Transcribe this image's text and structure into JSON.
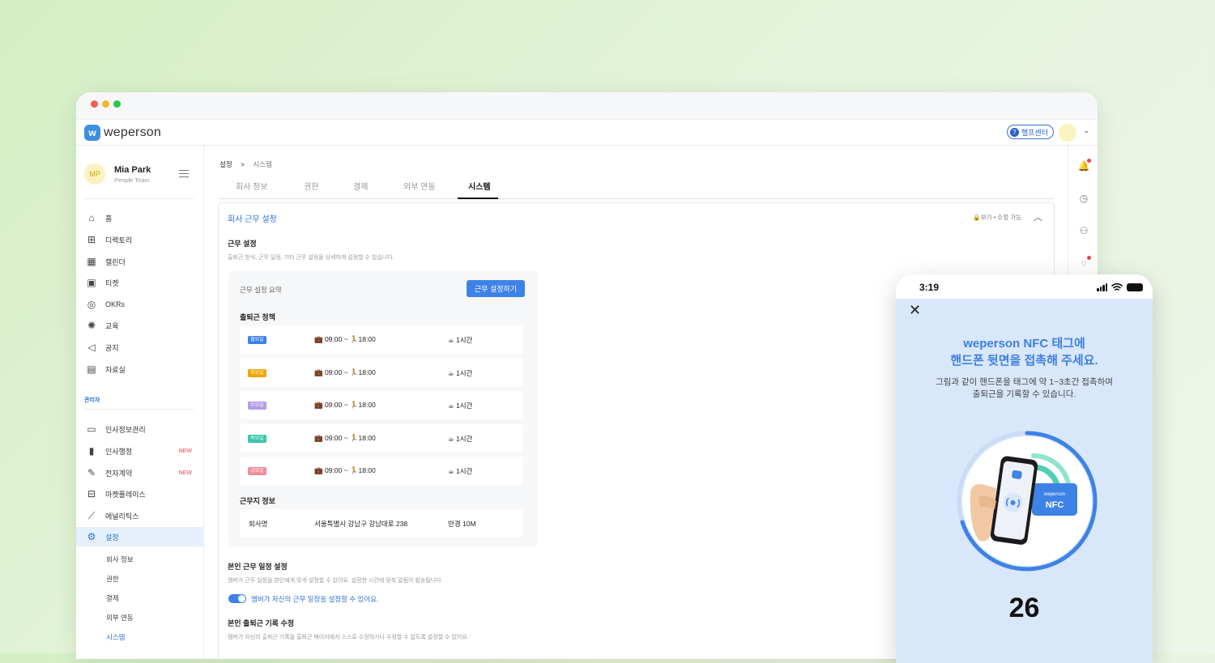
{
  "app": {
    "logo_text": "weperson",
    "logo_mark": "w",
    "help_label": "헬프센터",
    "help_icon": "?"
  },
  "profile": {
    "initials": "MP",
    "name": "Mia Park",
    "team": "People Team"
  },
  "sidebar": {
    "items": [
      {
        "label": "홈",
        "icon": "home-icon"
      },
      {
        "label": "디렉토리",
        "icon": "org-chart-icon"
      },
      {
        "label": "캘린더",
        "icon": "calendar-icon"
      },
      {
        "label": "티켓",
        "icon": "ticket-icon"
      },
      {
        "label": "OKRs",
        "icon": "target-icon"
      },
      {
        "label": "교육",
        "icon": "bulb-icon"
      },
      {
        "label": "공지",
        "icon": "megaphone-icon"
      },
      {
        "label": "자료실",
        "icon": "archive-icon"
      }
    ],
    "admin_label": "관리자",
    "admin_items": [
      {
        "label": "인사정보관리",
        "icon": "folder-user-icon",
        "badge": ""
      },
      {
        "label": "인사행정",
        "icon": "book-icon",
        "badge": "NEW"
      },
      {
        "label": "전자계약",
        "icon": "contract-icon",
        "badge": "NEW"
      },
      {
        "label": "마켓플레이스",
        "icon": "gift-icon",
        "badge": ""
      },
      {
        "label": "애널리틱스",
        "icon": "chart-icon",
        "badge": ""
      },
      {
        "label": "설정",
        "icon": "gear-icon",
        "badge": ""
      }
    ],
    "sub_items": [
      "회사 정보",
      "권한",
      "결제",
      "외부 연동",
      "시스템"
    ]
  },
  "breadcrumb": {
    "root": "설정",
    "sep": ">",
    "current": "시스템"
  },
  "tabs": [
    "회사 정보",
    "권한",
    "결제",
    "외부 연동",
    "시스템"
  ],
  "panel": {
    "title": "회사 근무 설정",
    "permission": "🔒보기 • 수정 가능",
    "section1_title": "근무 설정",
    "section1_desc": "출퇴근 방식, 근무 일정, 기타 근무 설정을 상세하게 설정할 수 있습니다.",
    "summary_label": "근무 설정 요약",
    "summary_button": "근무 설정하기",
    "policy_title": "출퇴근 정책",
    "days": [
      {
        "badge": "월요일",
        "color": "#3d82e6",
        "time": "💼 09:00 ~ 🏃18:00",
        "break": "☕ 1시간"
      },
      {
        "badge": "화요일",
        "color": "#f0a500",
        "time": "💼 09:00 ~ 🏃18:00",
        "break": "☕ 1시간"
      },
      {
        "badge": "수요일",
        "color": "#b59be6",
        "time": "💼 09:00 ~ 🏃18:00",
        "break": "☕ 1시간"
      },
      {
        "badge": "목요일",
        "color": "#3cc4a8",
        "time": "💼 09:00 ~ 🏃18:00",
        "break": "☕ 1시간"
      },
      {
        "badge": "금요일",
        "color": "#f08c99",
        "time": "💼 09:00 ~ 🏃18:00",
        "break": "☕ 1시간"
      }
    ],
    "location_title": "근무지 정보",
    "location": {
      "name": "회사명",
      "address": "서울특별시 강남구 강남대로 238",
      "radius": "반경 10M"
    },
    "section2_title": "본인 근무 일정 설정",
    "section2_desc": "멤버가 근무 일정을 본인에게 맞게 설정할 수 있어요. 설정한 시간에 맞춰 알림이 발송됩니다.",
    "section2_toggle": "멤버가 자신의 근무 일정을 설정할 수 있어요.",
    "section3_title": "본인 출퇴근 기록 수정",
    "section3_desc": "멤버가 자신의 출퇴근 기록을 출퇴근 페이지에서 스스로 수정하거나 수정할 수 없도록 설정할 수 있어요."
  },
  "phone": {
    "time": "3:19",
    "headline1": "weperson NFC 태그에",
    "headline2": "핸드폰 뒷면을 접촉해 주세요.",
    "sub1": "그림과 같이 핸드폰을 태그에 약 1~3초간 접촉하여",
    "sub2": "출퇴근을 기록할 수 있습니다.",
    "tag_brand": "weperson",
    "tag_label": "NFC",
    "countdown": "26",
    "progress": 0.3
  },
  "colors": {
    "accent": "#3d82e6",
    "brand": "#3d7fe0",
    "danger": "#e54545"
  }
}
